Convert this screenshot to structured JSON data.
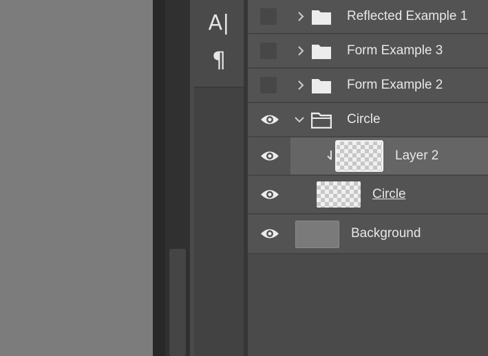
{
  "tools": {
    "character_glyph": "A|",
    "paragraph_glyph": "¶"
  },
  "layers": [
    {
      "name": "Reflected Example 1",
      "type": "group",
      "visible": false,
      "expanded": false,
      "selected": false
    },
    {
      "name": "Form Example 3",
      "type": "group",
      "visible": false,
      "expanded": false,
      "selected": false
    },
    {
      "name": "Form Example 2",
      "type": "group",
      "visible": false,
      "expanded": false,
      "selected": false
    },
    {
      "name": "Circle",
      "type": "group",
      "visible": true,
      "expanded": true,
      "selected": false
    },
    {
      "name": "Layer 2",
      "type": "pixel",
      "visible": true,
      "clipped": true,
      "selected": true
    },
    {
      "name": "Circle",
      "type": "shape",
      "visible": true,
      "selected": false
    },
    {
      "name": "Background",
      "type": "background",
      "visible": true,
      "selected": false
    }
  ],
  "colors": {
    "panel_bg": "#535353",
    "selected_row": "#656565",
    "canvas": "#7c7c7c",
    "text": "#e8e8e8"
  }
}
